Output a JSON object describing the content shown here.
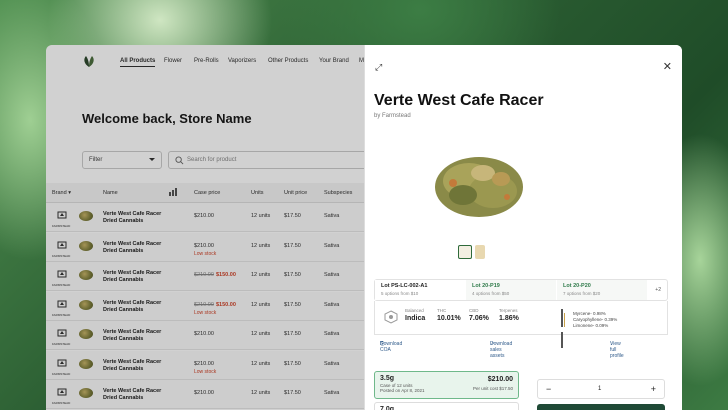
{
  "nav": {
    "items": [
      "All Products",
      "Flower",
      "Pre-Rolls",
      "Vaporizers",
      "Other Products",
      "Your Brand",
      "M"
    ]
  },
  "welcome": "Welcome back, Store Name",
  "filter": {
    "label": "Filter"
  },
  "search": {
    "placeholder": "Search for product"
  },
  "table": {
    "headers": {
      "brand": "Brand",
      "name": "Name",
      "case_price": "Case price",
      "units": "Units",
      "unit_price": "Unit price",
      "subspecies": "Subspecies"
    },
    "rows": [
      {
        "name": "Verte West Cafe Racer Dried Cannabis",
        "brand": "FARMSTEAD",
        "price": "$210.00",
        "old_price": "",
        "units": "12 units",
        "unit_price": "$17.50",
        "sub": "Sativa",
        "note": ""
      },
      {
        "name": "Verte West Cafe Racer Dried Cannabis",
        "brand": "FARMSTEAD",
        "price": "$210.00",
        "old_price": "",
        "units": "12 units",
        "unit_price": "$17.50",
        "sub": "Sativa",
        "note": "Low stock"
      },
      {
        "name": "Verte West Cafe Racer Dried Cannabis",
        "brand": "FARMSTEAD",
        "price": "$150.00",
        "old_price": "$210.00",
        "units": "12 units",
        "unit_price": "$17.50",
        "sub": "Sativa",
        "note": ""
      },
      {
        "name": "Verte West Cafe Racer Dried Cannabis",
        "brand": "FARMSTEAD",
        "price": "$150.00",
        "old_price": "$210.00",
        "units": "12 units",
        "unit_price": "$17.50",
        "sub": "Sativa",
        "note": "Low stock"
      },
      {
        "name": "Verte West Cafe Racer Dried Cannabis",
        "brand": "FARMSTEAD",
        "price": "$210.00",
        "old_price": "",
        "units": "12 units",
        "unit_price": "$17.50",
        "sub": "Sativa",
        "note": ""
      },
      {
        "name": "Verte West Cafe Racer Dried Cannabis",
        "brand": "FARMSTEAD",
        "price": "$210.00",
        "old_price": "",
        "units": "12 units",
        "unit_price": "$17.50",
        "sub": "Sativa",
        "note": "Low stock"
      },
      {
        "name": "Verte West Cafe Racer Dried Cannabis",
        "brand": "FARMSTEAD",
        "price": "$210.00",
        "old_price": "",
        "units": "12 units",
        "unit_price": "$17.50",
        "sub": "Sativa",
        "note": ""
      }
    ]
  },
  "panel": {
    "title": "Verte West Cafe Racer",
    "by": "by Farmstead",
    "lots": [
      {
        "name": "Lot PS-LC-002-A1",
        "sub": "5 options from $10"
      },
      {
        "name": "Lot 20-P19",
        "sub": "4 options from $50"
      },
      {
        "name": "Lot 20-P20",
        "sub": "7 options from $20"
      }
    ],
    "more_lots": "+2",
    "stats": {
      "balanced_label": "Balanced",
      "balanced_value": "Indica",
      "thc_label": "THC",
      "thc_value": "10.01%",
      "cbd_label": "CBD",
      "cbd_value": "7.06%",
      "terp_label": "Terpenes",
      "terp_value": "1.86%"
    },
    "terpenes": [
      "Myrcene- 0.98%",
      "Caryophyllene- 0.39%",
      "Limonene- 0.09%"
    ],
    "links": {
      "coa": "Download COA",
      "assets": "Download sales assets",
      "profile": "View full profile"
    },
    "size1": {
      "size": "3.5g",
      "case": "Case of 12 units",
      "posted": "Posted on Apr 8, 2021",
      "price": "$210.00",
      "per_unit": "Per unit cost $17.50"
    },
    "size2": {
      "size": "7.0g"
    },
    "qty": {
      "minus": "−",
      "value": "1",
      "plus": "+"
    }
  },
  "colors": {
    "accent": "#1f4a36",
    "sale": "#d0452b",
    "selected_bg": "#e8f4ec"
  }
}
